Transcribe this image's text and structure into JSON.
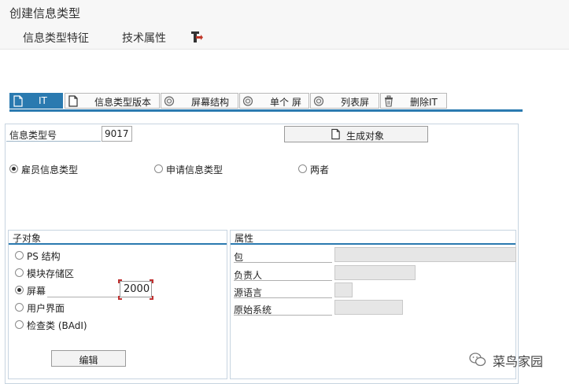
{
  "window": {
    "title": "创建信息类型"
  },
  "menu": {
    "item1": "信息类型特征",
    "item2": "技术属性"
  },
  "tabs": [
    {
      "label": "IT",
      "icon": "document-icon"
    },
    {
      "label": "信息类型版本",
      "icon": "document-icon"
    },
    {
      "label": "屏幕结构",
      "icon": "circle-icon"
    },
    {
      "label": "单个 屏",
      "icon": "circle-icon"
    },
    {
      "label": "列表屏",
      "icon": "circle-icon"
    },
    {
      "label": "删除IT",
      "icon": "trash-icon"
    }
  ],
  "form": {
    "infotype_label": "信息类型号",
    "infotype_value": "9017",
    "generate_button": "生成对象",
    "radio_employee": "雇员信息类型",
    "radio_applicant": "申请信息类型",
    "radio_both": "两者",
    "selected_category": "雇员信息类型"
  },
  "subobjects": {
    "header": "子对象",
    "options": [
      "PS 结构",
      "模块存储区",
      "屏幕",
      "用户界面",
      "检查类 (BAdI)"
    ],
    "selected": "屏幕",
    "screen_number": "2000",
    "edit_button": "编辑"
  },
  "attributes": {
    "header": "属性",
    "labels": [
      "包",
      "负责人",
      "源语言",
      "原始系统"
    ]
  },
  "watermark": {
    "text": "菜鸟家园"
  },
  "colors": {
    "accent": "#2a7ab0",
    "field_disabled": "#e6e6e6"
  }
}
